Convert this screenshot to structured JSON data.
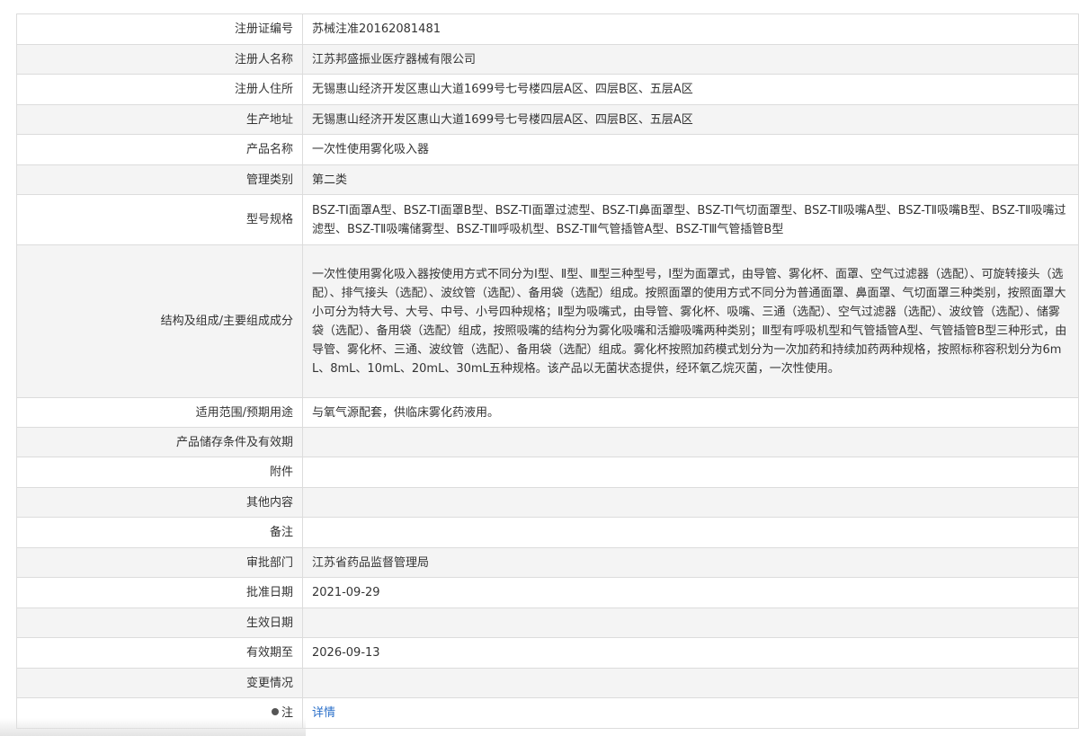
{
  "rows": [
    {
      "label": "注册证编号",
      "value": "苏械注准20162081481"
    },
    {
      "label": "注册人名称",
      "value": "江苏邦盛振业医疗器械有限公司"
    },
    {
      "label": "注册人住所",
      "value": "无锡惠山经济开发区惠山大道1699号七号楼四层A区、四层B区、五层A区"
    },
    {
      "label": "生产地址",
      "value": "无锡惠山经济开发区惠山大道1699号七号楼四层A区、四层B区、五层A区"
    },
    {
      "label": "产品名称",
      "value": "一次性使用雾化吸入器"
    },
    {
      "label": "管理类别",
      "value": "第二类"
    },
    {
      "label": "型号规格",
      "value": "BSZ-TⅠ面罩A型、BSZ-TⅠ面罩B型、BSZ-TⅠ面罩过滤型、BSZ-TⅠ鼻面罩型、BSZ-TⅠ气切面罩型、BSZ-TⅡ吸嘴A型、BSZ-TⅡ吸嘴B型、BSZ-TⅡ吸嘴过滤型、BSZ-TⅡ吸嘴储雾型、BSZ-TⅢ呼吸机型、BSZ-TⅢ气管插管A型、BSZ-TⅢ气管插管B型"
    },
    {
      "label": "结构及组成/主要组成成分",
      "value": "一次性使用雾化吸入器按使用方式不同分为Ⅰ型、Ⅱ型、Ⅲ型三种型号，Ⅰ型为面罩式，由导管、雾化杯、面罩、空气过滤器（选配）、可旋转接头（选配）、排气接头（选配）、波纹管（选配）、备用袋（选配）组成。按照面罩的使用方式不同分为普通面罩、鼻面罩、气切面罩三种类别，按照面罩大小可分为特大号、大号、中号、小号四种规格；Ⅱ型为吸嘴式，由导管、雾化杯、吸嘴、三通（选配）、空气过滤器（选配）、波纹管（选配）、储雾袋（选配）、备用袋（选配）组成，按照吸嘴的结构分为雾化吸嘴和活瓣吸嘴两种类别；Ⅲ型有呼吸机型和气管插管A型、气管插管B型三种形式，由导管、雾化杯、三通、波纹管（选配）、备用袋（选配）组成。雾化杯按照加药模式划分为一次加药和持续加药两种规格，按照标称容积划分为6mL、8mL、10mL、20mL、30mL五种规格。该产品以无菌状态提供，经环氧乙烷灭菌，一次性使用。"
    },
    {
      "label": "适用范围/预期用途",
      "value": "与氧气源配套，供临床雾化药液用。"
    },
    {
      "label": "产品储存条件及有效期",
      "value": ""
    },
    {
      "label": "附件",
      "value": ""
    },
    {
      "label": "其他内容",
      "value": ""
    },
    {
      "label": "备注",
      "value": ""
    },
    {
      "label": "审批部门",
      "value": "江苏省药品监督管理局"
    },
    {
      "label": "批准日期",
      "value": "2021-09-29"
    },
    {
      "label": "生效日期",
      "value": ""
    },
    {
      "label": "有效期至",
      "value": "2026-09-13"
    },
    {
      "label": "变更情况",
      "value": ""
    }
  ],
  "note_row": {
    "label": "注",
    "icon": "bullet-dot-icon",
    "link_text": "详情",
    "link_color": "#2a6fc9"
  }
}
